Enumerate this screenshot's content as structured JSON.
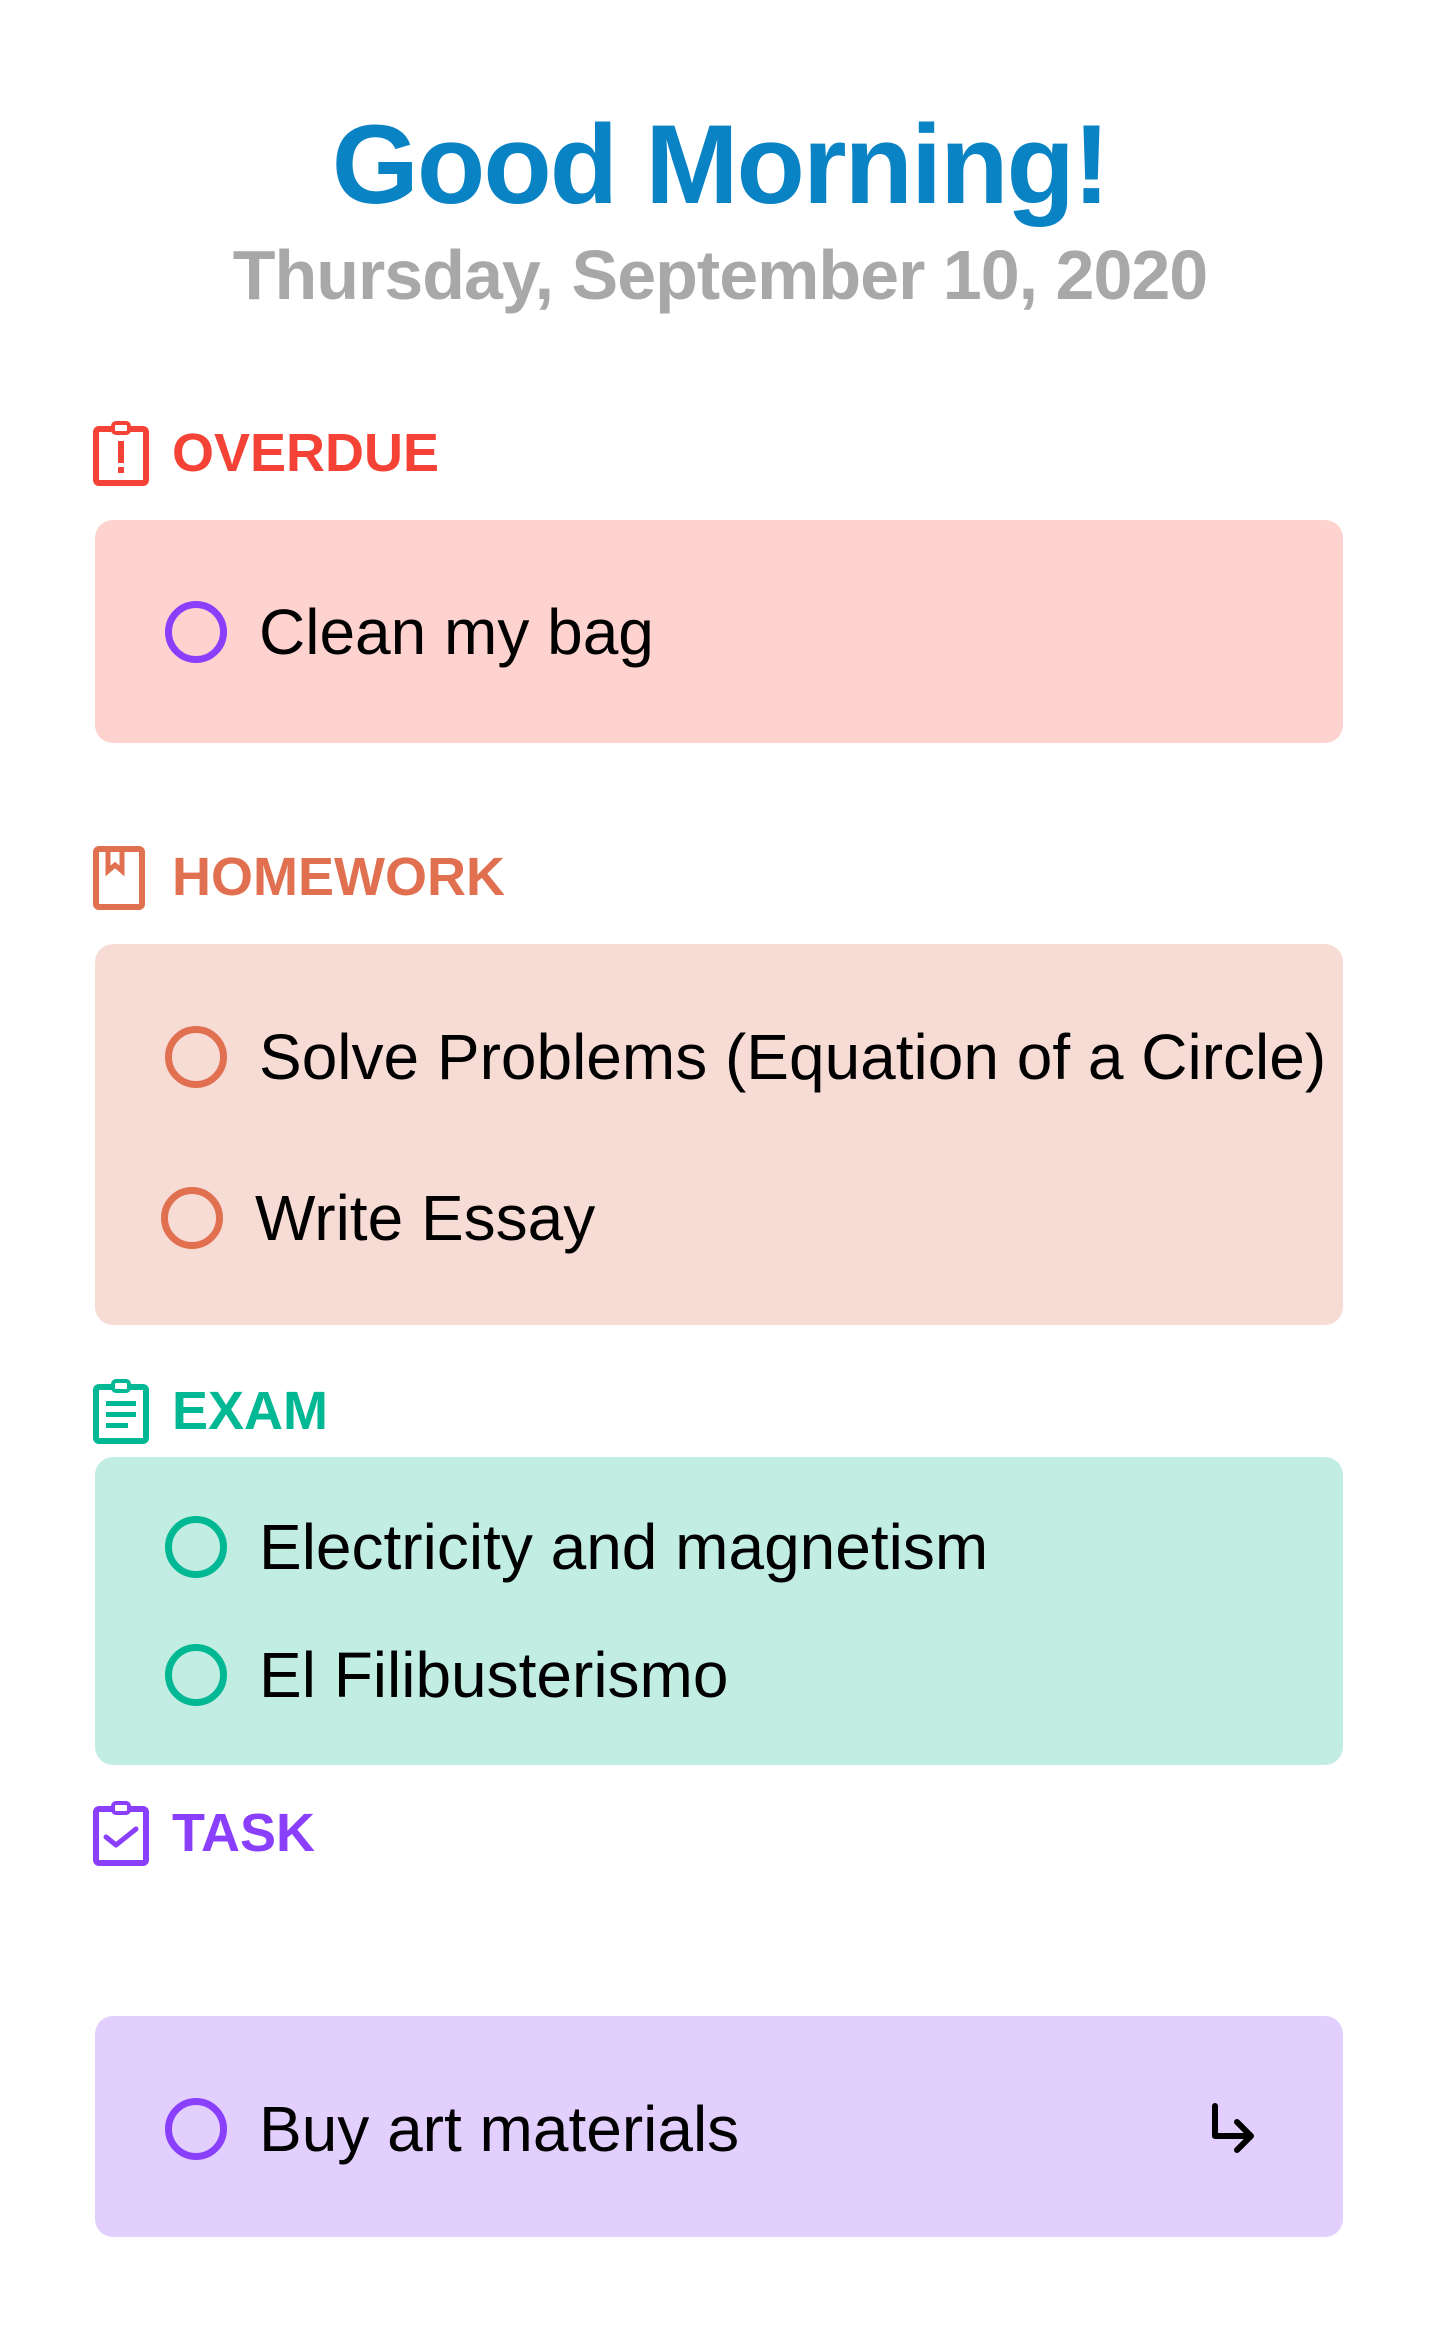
{
  "header": {
    "greeting": "Good Morning!",
    "date": "Thursday, September 10, 2020"
  },
  "colors": {
    "title": "#0a83c4",
    "date": "#a8a8a8",
    "overdue": "#f44336",
    "homework": "#e0704f",
    "exam": "#00b894",
    "task": "#8a3ffc"
  },
  "sections": [
    {
      "label": "OVERDUE",
      "icon": "clipboard-alert-icon",
      "color": "#f44336",
      "card_bg": "#fdd2cf",
      "items": [
        {
          "text": "Clean my bag",
          "circle_color": "#8a3ffc"
        }
      ]
    },
    {
      "label": "HOMEWORK",
      "icon": "bookmark-book-icon",
      "color": "#e0704f",
      "card_bg": "#f7dcd6",
      "items": [
        {
          "text": "Solve Problems (Equation of a Circle)",
          "circle_color": "#e0704f"
        },
        {
          "text": "Write Essay",
          "circle_color": "#e0704f"
        }
      ]
    },
    {
      "label": "EXAM",
      "icon": "clipboard-list-icon",
      "color": "#00b894",
      "card_bg": "#c2ede3",
      "items": [
        {
          "text": "Electricity and magnetism",
          "circle_color": "#00b894"
        },
        {
          "text": "El Filibusterismo",
          "circle_color": "#00b894"
        }
      ]
    },
    {
      "label": "TASK",
      "icon": "clipboard-check-icon",
      "color": "#8a3ffc",
      "card_bg": "#e2cffd",
      "items": [
        {
          "text": "Buy art materials",
          "circle_color": "#8a3ffc",
          "action_icon": "arrow-turn-down-right-icon"
        }
      ]
    }
  ]
}
